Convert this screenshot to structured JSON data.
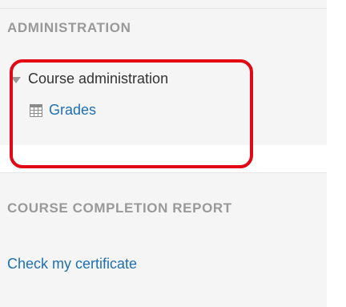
{
  "administration_block": {
    "title": "ADMINISTRATION",
    "course_admin_label": "Course administration",
    "grades_label": "Grades",
    "grades_icon": "grades-table-icon"
  },
  "completion_block": {
    "title": "COURSE COMPLETION REPORT",
    "link_label": "Check my certificate"
  },
  "colors": {
    "heading": "#999999",
    "link": "#1f6fb2",
    "highlight": "#e30613"
  }
}
